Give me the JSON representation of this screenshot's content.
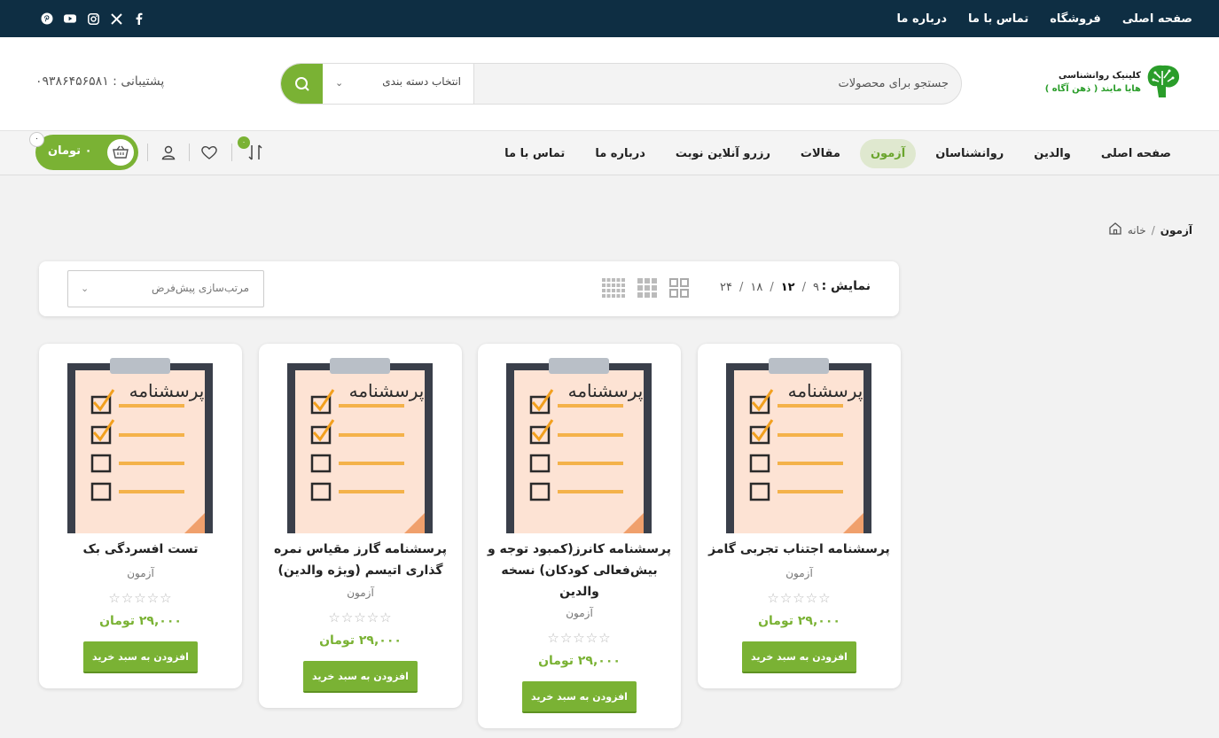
{
  "topbar": {
    "links": [
      "صفحه اصلی",
      "فروشگاه",
      "تماس با ما",
      "درباره ما"
    ],
    "socials": [
      "facebook-icon",
      "x-icon",
      "instagram-icon",
      "youtube-icon",
      "pinterest-icon"
    ]
  },
  "header": {
    "logo_line1": "کلینیک روانشناسی",
    "logo_line2": "هایا مایند ( ذهن آگاه )",
    "search_placeholder": "جستجو برای محصولات",
    "category_label": "انتخاب دسته بندی",
    "support": "پشتیبانی : ۰۹۳۸۶۴۵۶۵۸۱"
  },
  "nav": {
    "items": [
      "صفحه اصلی",
      "والدین",
      "روانشناسان",
      "آزمون",
      "مقالات",
      "رزرو آنلاین نوبت",
      "درباره ما",
      "تماس با ما"
    ],
    "active_index": 3,
    "cart_amount": "۰ تومان",
    "cart_count": "۰",
    "compare_count": "۰"
  },
  "breadcrumb": {
    "home": "خانه",
    "separator": "/",
    "current": "آزمون"
  },
  "toolbar": {
    "show_label": "نمایش :",
    "show_options": [
      "۹",
      "۱۲",
      "۱۸",
      "۲۴"
    ],
    "selected_option": "۱۲",
    "sort_label": "مرتب‌سازی پیش‌فرض"
  },
  "products": [
    {
      "title": "پرسشنامه اجتناب تجربی گامز",
      "category": "آزمون",
      "price": "۲۹,۰۰۰ تومان",
      "button": "افزودن به سبد خرید",
      "image_label": "پرسشنامه",
      "rating": 0
    },
    {
      "title": "پرسشنامه کانرز(کمبود توجه و بیش‌فعالی کودکان) نسخه والدین",
      "category": "آزمون",
      "price": "۲۹,۰۰۰ تومان",
      "button": "افزودن به سبد خرید",
      "image_label": "پرسشنامه",
      "rating": 0
    },
    {
      "title": "پرسشنامه گارز مقیاس نمره گذاری اتیسم (ویژه والدین)",
      "category": "آزمون",
      "price": "۲۹,۰۰۰ تومان",
      "button": "افزودن به سبد خرید",
      "image_label": "پرسشنامه",
      "rating": 0
    },
    {
      "title": "تست افسردگی بک",
      "category": "آزمون",
      "price": "۲۹,۰۰۰ تومان",
      "button": "افزودن به سبد خرید",
      "image_label": "پرسشنامه",
      "rating": 0
    }
  ],
  "colors": {
    "accent": "#7ab234",
    "topbar": "#0e2e43"
  }
}
